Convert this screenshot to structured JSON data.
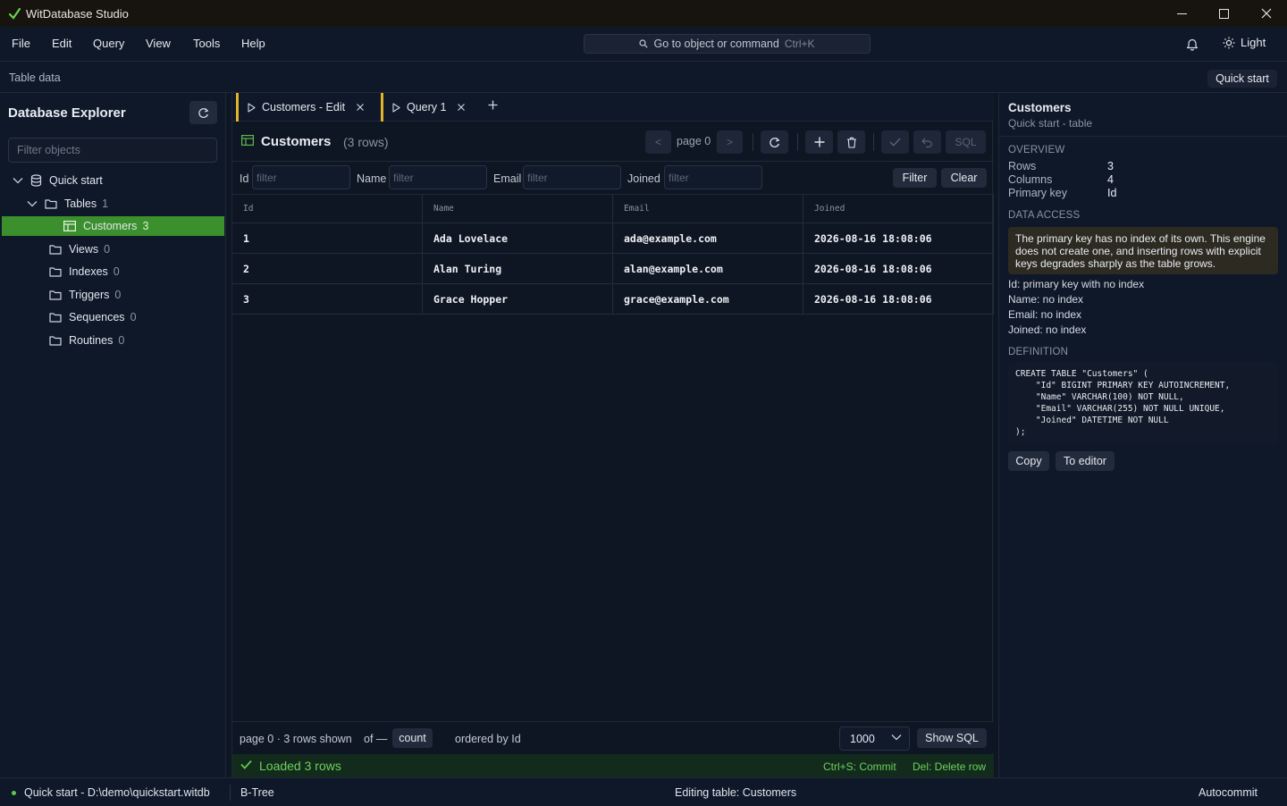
{
  "window": {
    "title": "WitDatabase Studio"
  },
  "menu": {
    "items": [
      "File",
      "Edit",
      "Query",
      "View",
      "Tools",
      "Help"
    ],
    "search_placeholder": "Go to object or command",
    "search_shortcut": "Ctrl+K",
    "theme_label": "Light"
  },
  "subheader": {
    "breadcrumb": "Table data",
    "quick_start_label": "Quick start"
  },
  "explorer": {
    "title": "Database Explorer",
    "filter_placeholder": "Filter objects",
    "tree": [
      {
        "label": "Quick start",
        "count": "",
        "level": 0
      },
      {
        "label": "Tables",
        "count": "1",
        "level": 1
      },
      {
        "label": "Customers",
        "count": "3",
        "level": 2
      },
      {
        "label": "Views",
        "count": "0",
        "level": 1
      },
      {
        "label": "Indexes",
        "count": "0",
        "level": 1
      },
      {
        "label": "Triggers",
        "count": "0",
        "level": 1
      },
      {
        "label": "Sequences",
        "count": "0",
        "level": 1
      },
      {
        "label": "Routines",
        "count": "0",
        "level": 1
      }
    ]
  },
  "tabs": [
    {
      "label": "Customers - Edit"
    },
    {
      "label": "Query 1"
    }
  ],
  "table_view": {
    "name": "Customers",
    "rows_label": "(3 rows)",
    "page_label": "page 0",
    "prev_label": "<",
    "next_label": ">",
    "sql_label": "SQL",
    "filters": [
      {
        "label": "Id",
        "placeholder": "filter"
      },
      {
        "label": "Name",
        "placeholder": "filter"
      },
      {
        "label": "Email",
        "placeholder": "filter"
      },
      {
        "label": "Joined",
        "placeholder": "filter"
      }
    ],
    "filter_btn": "Filter",
    "clear_btn": "Clear",
    "columns": [
      "Id",
      "Name",
      "Email",
      "Joined"
    ],
    "rows": [
      [
        "1",
        "Ada Lovelace",
        "ada@example.com",
        "2026-08-16 18:08:06"
      ],
      [
        "2",
        "Alan Turing",
        "alan@example.com",
        "2026-08-16 18:08:06"
      ],
      [
        "3",
        "Grace Hopper",
        "grace@example.com",
        "2026-08-16 18:08:06"
      ]
    ]
  },
  "footer": {
    "page_info": "page 0 · 3 rows shown",
    "of_label": "of —",
    "count_btn": "count",
    "order_info": "ordered by Id",
    "limit_value": "1000",
    "show_sql_btn": "Show SQL",
    "status_msg": "Loaded 3 rows",
    "hint_commit": "Ctrl+S: Commit",
    "hint_delete": "Del: Delete row"
  },
  "details": {
    "title": "Customers",
    "subtitle": "Quick start - table",
    "overview_heading": "OVERVIEW",
    "overview": [
      {
        "key": "Rows",
        "value": "3"
      },
      {
        "key": "Columns",
        "value": "4"
      },
      {
        "key": "Primary key",
        "value": "Id"
      }
    ],
    "data_access_heading": "DATA ACCESS",
    "warning": "The primary key has no index of its own. This engine does not create one, and inserting rows with explicit keys degrades sharply as the table grows.",
    "index_notes": [
      "Id: primary key with no index",
      "Name: no index",
      "Email: no index",
      "Joined: no index"
    ],
    "definition_heading": "DEFINITION",
    "ddl": "CREATE TABLE \"Customers\" (\n    \"Id\" BIGINT PRIMARY KEY AUTOINCREMENT,\n    \"Name\" VARCHAR(100) NOT NULL,\n    \"Email\" VARCHAR(255) NOT NULL UNIQUE,\n    \"Joined\" DATETIME NOT NULL\n);",
    "copy_btn": "Copy",
    "to_editor_btn": "To editor"
  },
  "statusbar": {
    "connection": "Quick start - D:\\demo\\quickstart.witdb",
    "engine": "B-Tree",
    "editing": "Editing table: Customers",
    "mode": "Autocommit"
  },
  "colors": {
    "accent_green": "#3b8f2d",
    "tab_marker": "#e0b32a",
    "success_text": "#6fd05a"
  }
}
